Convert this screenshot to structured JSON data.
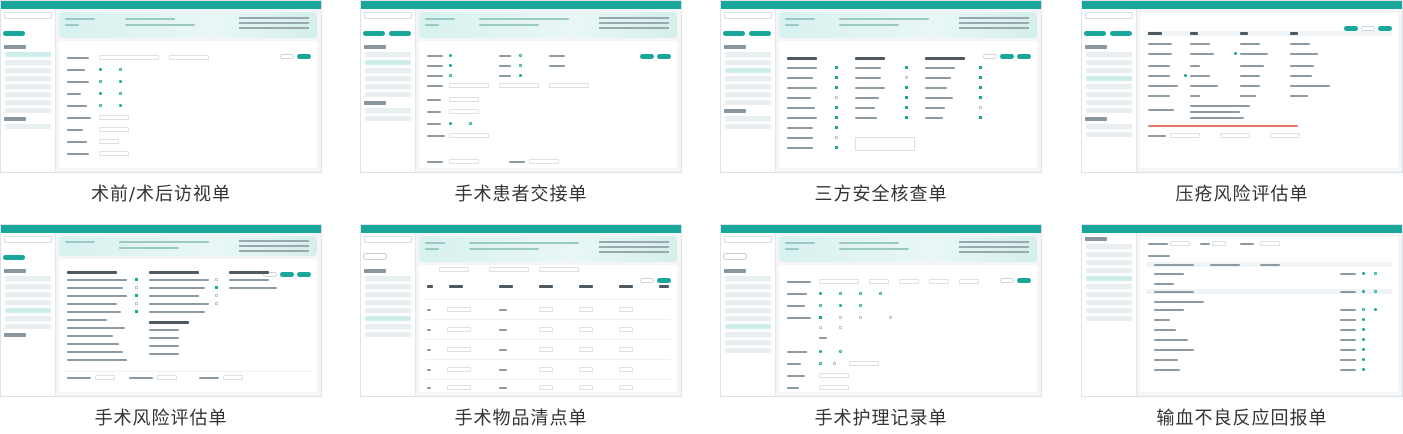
{
  "tiles": [
    {
      "caption": "术前/术后访视单"
    },
    {
      "caption": "手术患者交接单"
    },
    {
      "caption": "三方安全核查单"
    },
    {
      "caption": "压疮风险评估单"
    },
    {
      "caption": "手术风险评估单"
    },
    {
      "caption": "手术物品清点单"
    },
    {
      "caption": "手术护理记录单"
    },
    {
      "caption": "输血不良反应回报单"
    }
  ],
  "colors": {
    "accent": "#1aa79b",
    "header_gradient": "#d7f2ef",
    "caption_text": "#333333"
  }
}
